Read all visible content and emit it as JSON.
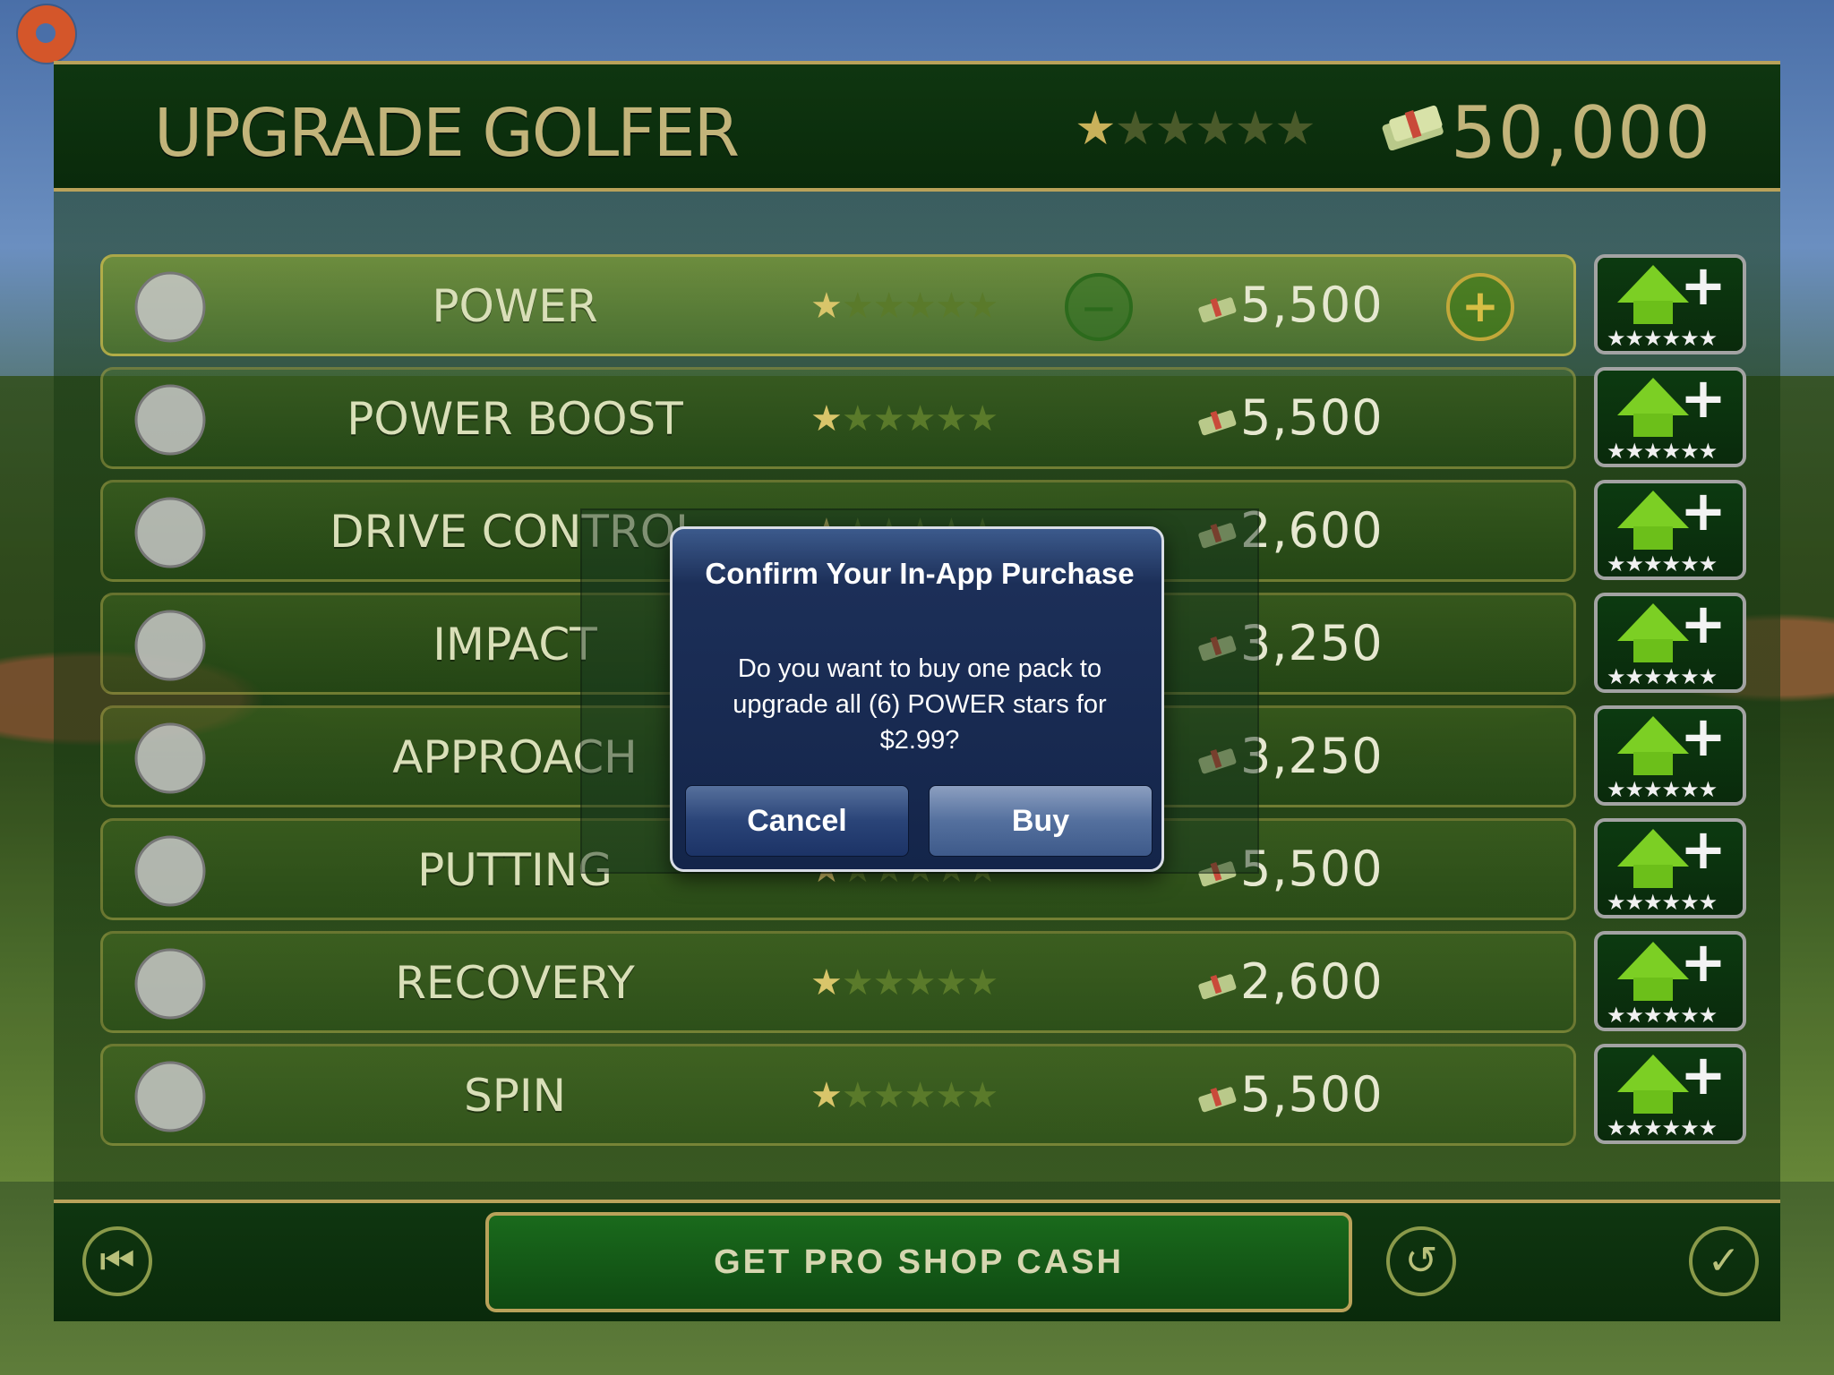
{
  "header": {
    "title": "UPGRADE GOLFER",
    "stars_filled": 1,
    "stars_total": 6,
    "cash": "50,000"
  },
  "rows": [
    {
      "label": "POWER",
      "price": "5,500",
      "stars_filled": 1,
      "stars_total": 6,
      "icon": "glove-icon",
      "active": true
    },
    {
      "label": "POWER BOOST",
      "price": "5,500",
      "stars_filled": 1,
      "stars_total": 6,
      "icon": "tee-icon"
    },
    {
      "label": "DRIVE CONTROL",
      "price": "2,600",
      "stars_filled": 1,
      "stars_total": 6,
      "icon": "driver-icon"
    },
    {
      "label": "IMPACT",
      "price": "3,250",
      "stars_filled": 1,
      "stars_total": 6,
      "icon": "iron-icon"
    },
    {
      "label": "APPROACH",
      "price": "3,250",
      "stars_filled": 1,
      "stars_total": 6,
      "icon": "wedge-icon"
    },
    {
      "label": "PUTTING",
      "price": "5,500",
      "stars_filled": 1,
      "stars_total": 6,
      "icon": "putter-icon"
    },
    {
      "label": "RECOVERY",
      "price": "2,600",
      "stars_filled": 1,
      "stars_total": 6,
      "icon": "grip-icon"
    },
    {
      "label": "SPIN",
      "price": "5,500",
      "stars_filled": 1,
      "stars_total": 6,
      "icon": "golf-ball-icon"
    }
  ],
  "dialog": {
    "title": "Confirm Your In-App Purchase",
    "message": "Do you want to buy one pack to upgrade all (6) POWER stars for $2.99?",
    "cancel_label": "Cancel",
    "buy_label": "Buy"
  },
  "footer": {
    "pro_shop_label": "GET PRO SHOP CASH"
  },
  "colors": {
    "accent_gold": "#b9a25a",
    "upgrade_green": "#7ccf24",
    "dialog_blue": "#14254a"
  }
}
